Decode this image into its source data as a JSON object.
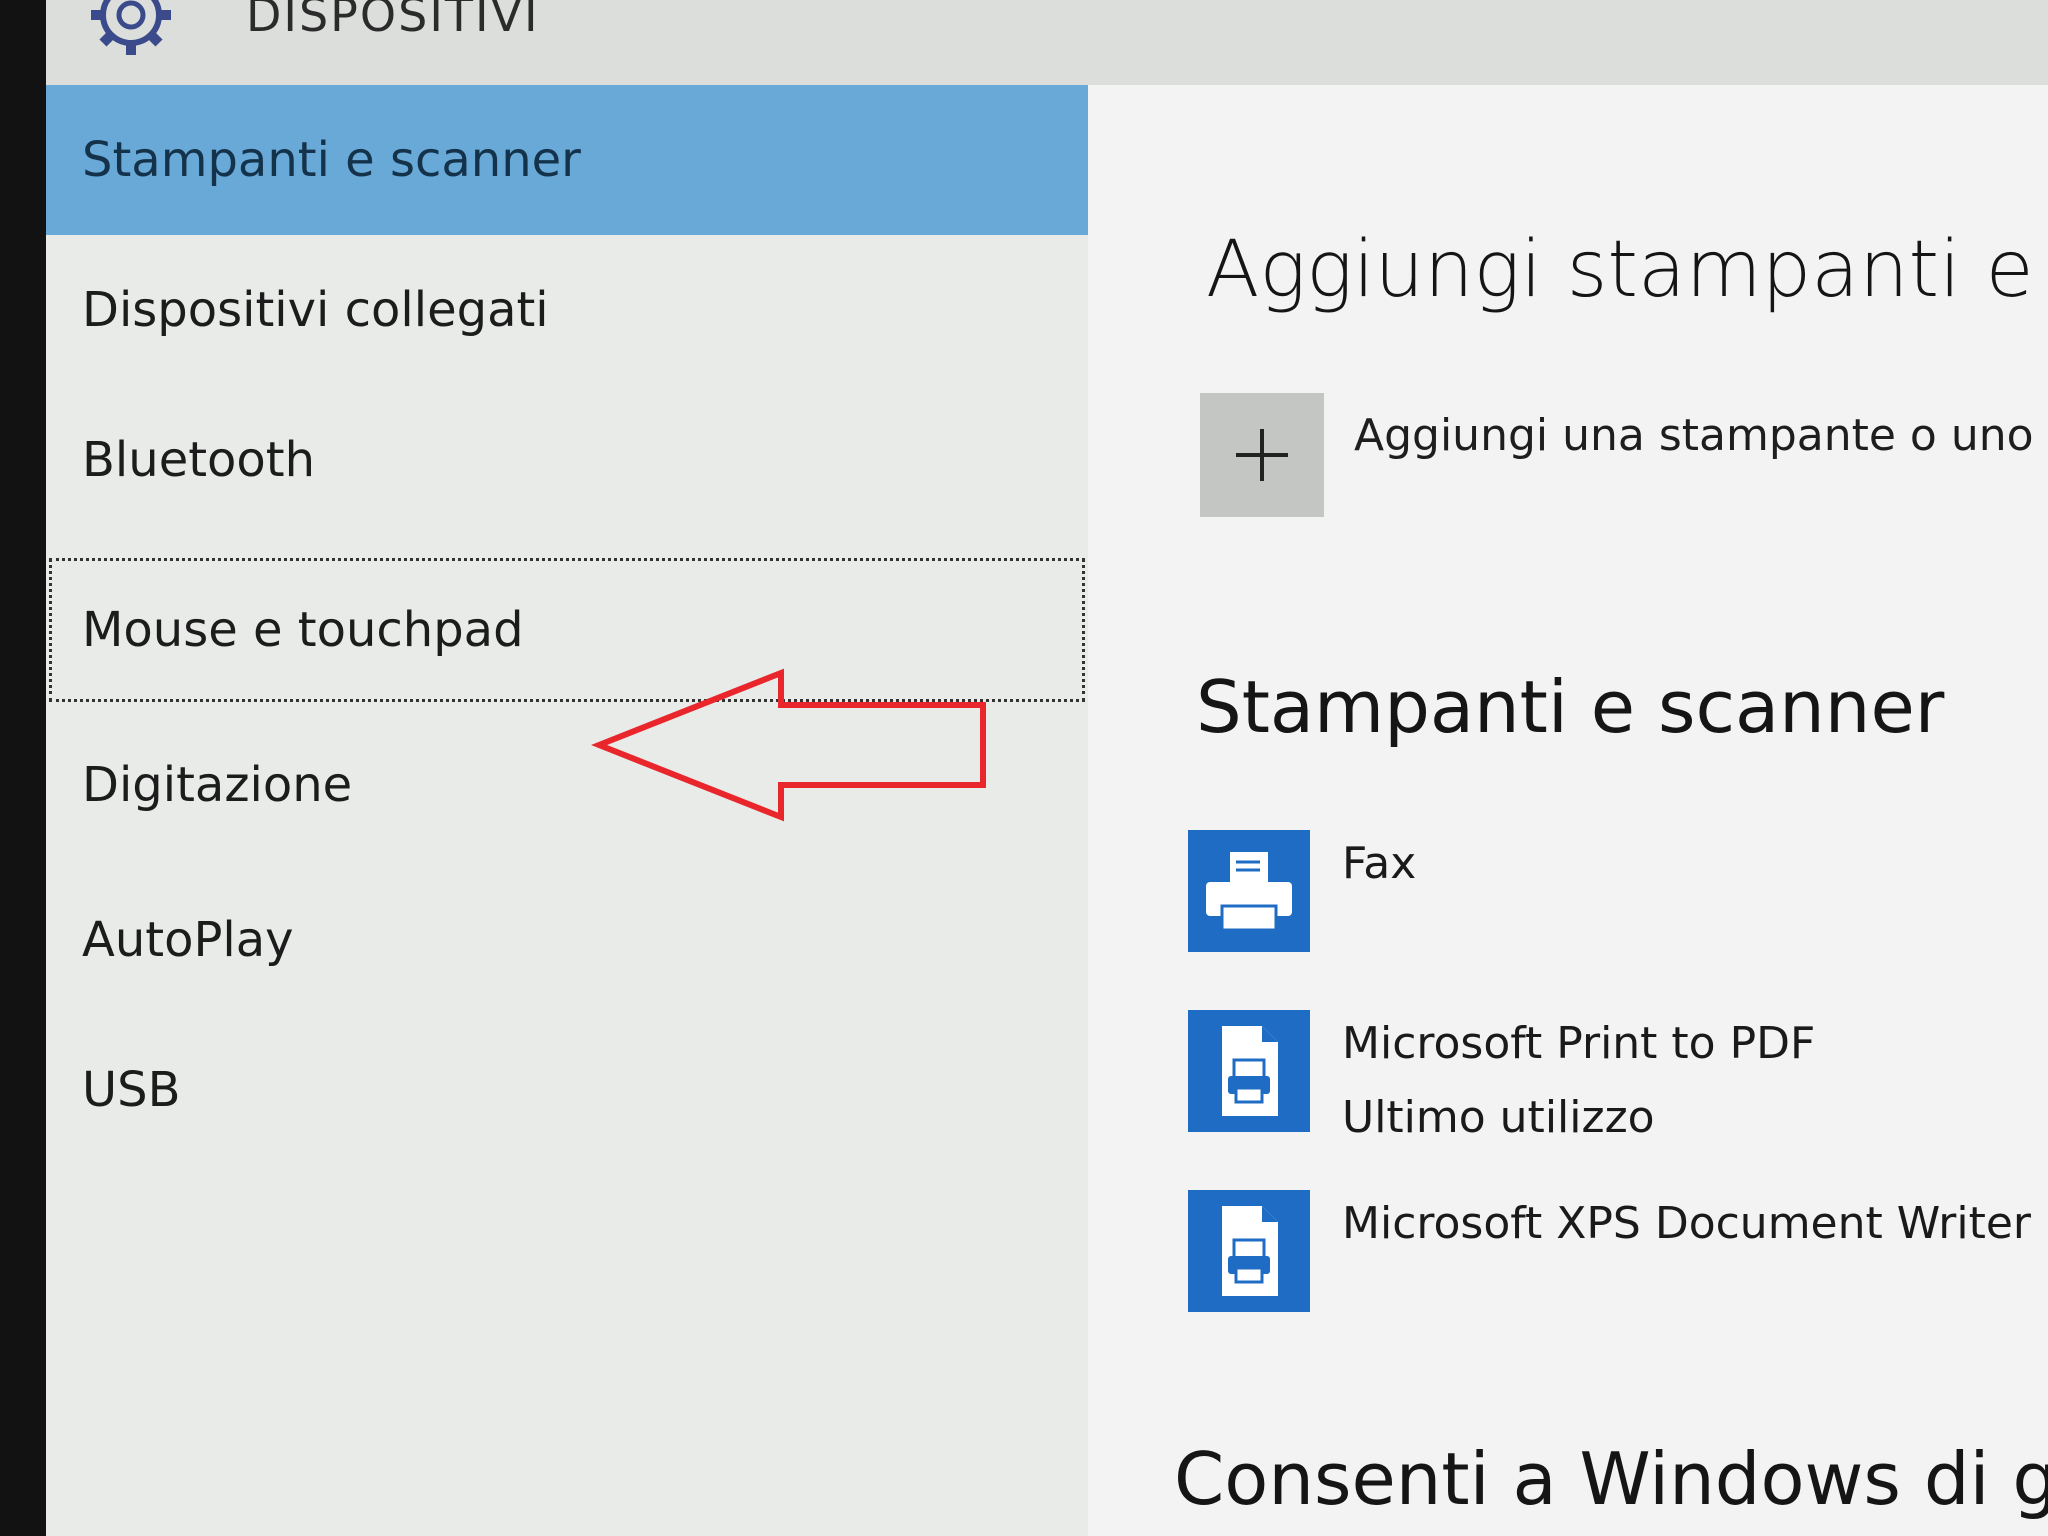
{
  "header": {
    "title": "DISPOSITIVI",
    "icon": "gear-icon"
  },
  "sidebar": {
    "items": [
      {
        "label": "Stampanti e scanner",
        "selected": true
      },
      {
        "label": "Dispositivi collegati"
      },
      {
        "label": "Bluetooth"
      },
      {
        "label": "Mouse e touchpad",
        "focused": true
      },
      {
        "label": "Digitazione"
      },
      {
        "label": "AutoPlay"
      },
      {
        "label": "USB"
      }
    ]
  },
  "content": {
    "add_section_title": "Aggiungi stampanti e scanner",
    "add_button_label": "Aggiungi una stampante o uno scanner",
    "printers_section_title": "Stampanti e scanner",
    "printers": [
      {
        "name": "Fax",
        "subtitle": "",
        "icon": "printer-icon"
      },
      {
        "name": "Microsoft Print to PDF",
        "subtitle": "Ultimo utilizzo",
        "icon": "document-printer-icon"
      },
      {
        "name": "Microsoft XPS Document Writer",
        "subtitle": "",
        "icon": "document-printer-icon"
      }
    ],
    "footer_heading": "Consenti a Windows di gestire la stampante predefinita"
  },
  "colors": {
    "selected_nav": "#68a9d8",
    "tile_blue": "#1f6cc5",
    "annotation_arrow": "#e8262b"
  }
}
